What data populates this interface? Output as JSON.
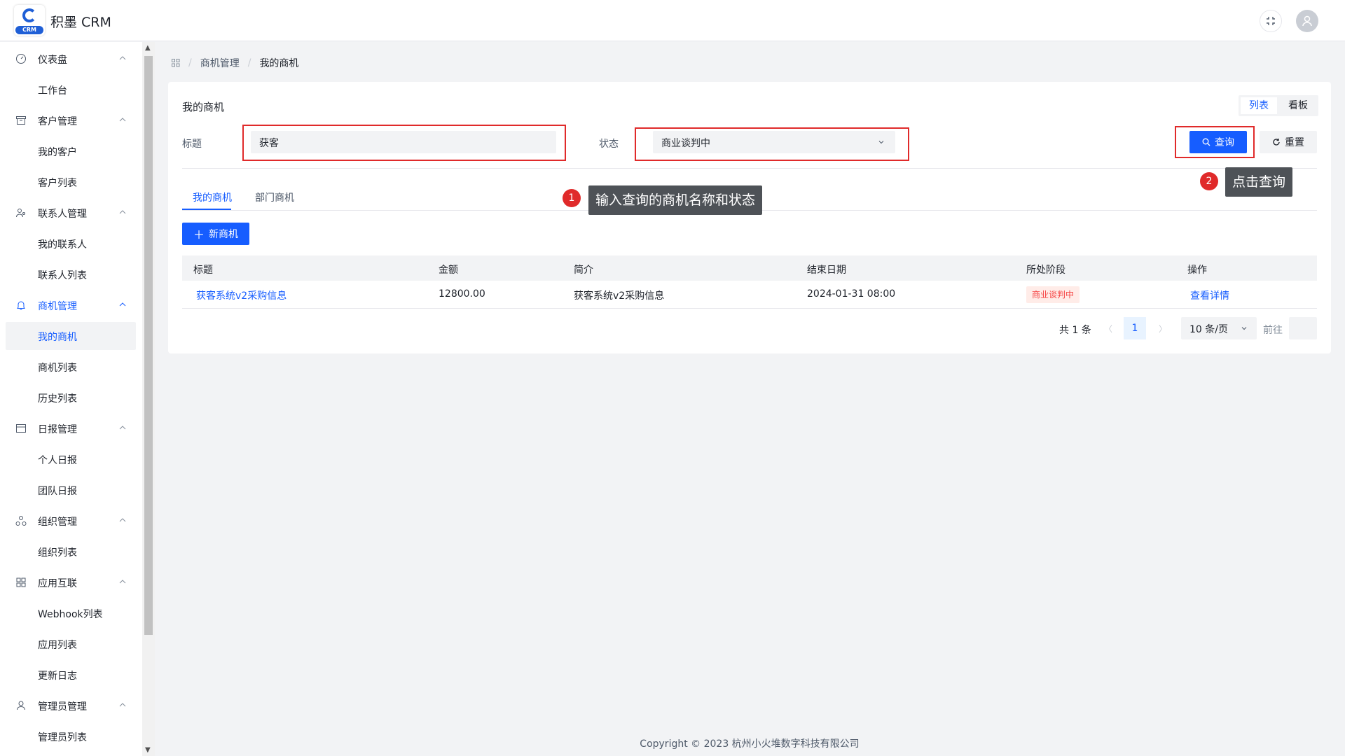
{
  "app": {
    "title": "积墨 CRM",
    "logo_badge": "CRM"
  },
  "header": {
    "fullscreen_icon": "fullscreen-exit-icon",
    "avatar_icon": "user-icon"
  },
  "sidebar": {
    "groups": [
      {
        "label": "仪表盘",
        "icon": "dashboard-icon",
        "items": [
          "工作台"
        ]
      },
      {
        "label": "客户管理",
        "icon": "archive-icon",
        "items": [
          "我的客户",
          "客户列表"
        ]
      },
      {
        "label": "联系人管理",
        "icon": "contacts-icon",
        "items": [
          "我的联系人",
          "联系人列表"
        ]
      },
      {
        "label": "商机管理",
        "icon": "bell-icon",
        "items": [
          "我的商机",
          "商机列表",
          "历史列表"
        ]
      },
      {
        "label": "日报管理",
        "icon": "calendar-icon",
        "items": [
          "个人日报",
          "团队日报"
        ]
      },
      {
        "label": "组织管理",
        "icon": "org-icon",
        "items": [
          "组织列表"
        ]
      },
      {
        "label": "应用互联",
        "icon": "apps-icon",
        "items": [
          "Webhook列表",
          "应用列表",
          "更新日志"
        ]
      },
      {
        "label": "管理员管理",
        "icon": "admin-icon",
        "items": [
          "管理员列表"
        ]
      }
    ],
    "selected": "我的商机"
  },
  "breadcrumb": {
    "home_icon": "apps-grid-icon",
    "items": [
      "商机管理",
      "我的商机"
    ]
  },
  "card": {
    "title": "我的商机",
    "view_switch": {
      "list": "列表",
      "board": "看板"
    }
  },
  "filters": {
    "title_label": "标题",
    "title_value": "获客",
    "status_label": "状态",
    "status_value": "商业谈判中",
    "search_button": "查询",
    "reset_button": "重置"
  },
  "tabs": [
    "我的商机",
    "部门商机"
  ],
  "new_button": "新商机",
  "table": {
    "columns": [
      "标题",
      "金额",
      "简介",
      "结束日期",
      "所处阶段",
      "操作"
    ],
    "rows": [
      {
        "title": "获客系统v2采购信息",
        "amount": "12800.00",
        "intro": "获客系统v2采购信息",
        "end_date": "2024-01-31 08:00",
        "stage": "商业谈判中",
        "action": "查看详情"
      }
    ]
  },
  "pagination": {
    "total": "共 1 条",
    "current_page": "1",
    "page_size": "10 条/页",
    "goto_label": "前往"
  },
  "annotations": [
    {
      "number": "1",
      "text": "输入查询的商机名称和状态"
    },
    {
      "number": "2",
      "text": "点击查询"
    }
  ],
  "footer": "Copyright © 2023 杭州小火堆数字科技有限公司",
  "colors": {
    "primary": "#165dff",
    "highlight": "#e02a2a",
    "tag_bg": "#ffece8",
    "tag_text": "#f53f3f"
  }
}
